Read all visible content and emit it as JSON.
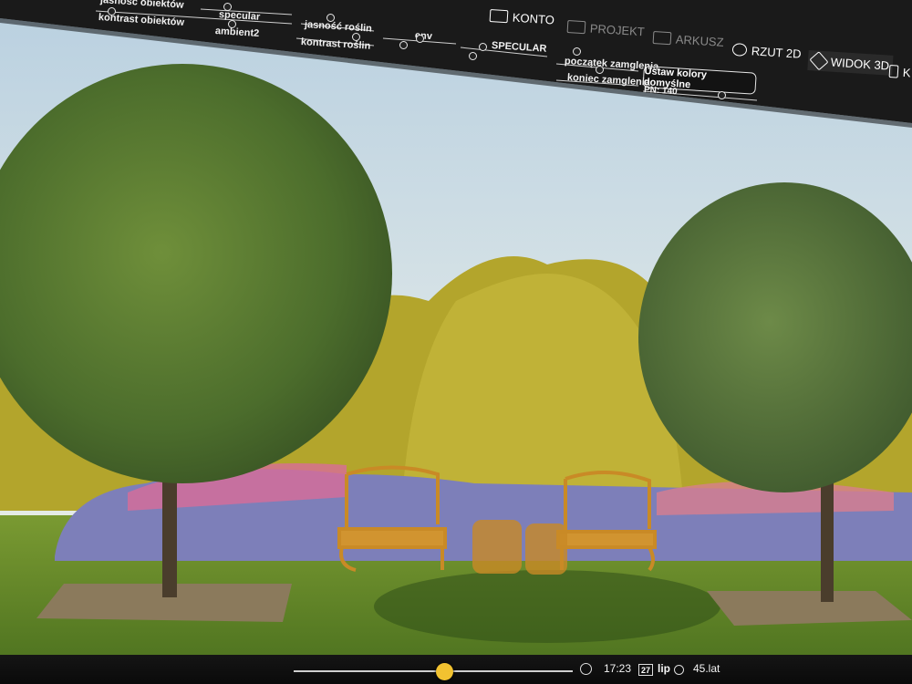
{
  "sliders": {
    "jasnosc_obiektow": "jasność obiektów",
    "kontrast_obiektow": "kontrast obiektów",
    "specular": "specular",
    "ambient2": "ambient2",
    "jasnosc_roslin": "jasność roślin",
    "kontrast_roslin": "kontrast roślin",
    "env": "env",
    "specular_upper": "SPECULAR",
    "poczatek_zamglenia": "początek zamglenia",
    "koniec_zamglenia": "koniec zamglenia"
  },
  "reset_button": "Ustaw kolory domyślne",
  "pn_label": "PN: 140",
  "nav": {
    "konto": "KONTO",
    "projekt": "PROJEKT",
    "arkusz": "ARKUSZ",
    "rzut2d": "RZUT 2D",
    "widok3d": "WIDOK 3D",
    "truncated": "K"
  },
  "bottom": {
    "time": "17:23",
    "day": "27",
    "month": "lip",
    "age": "45.lat",
    "time_slider_fraction": 0.54
  },
  "colors": {
    "accent": "#f2c230",
    "toolbar_bg": "#1a1a1a",
    "text": "#f1f1f1"
  },
  "icons": [
    "account-icon",
    "project-icon",
    "sheet-icon",
    "plan-2d-icon",
    "view-3d-icon",
    "clock-icon",
    "calendar-icon",
    "age-icon"
  ]
}
